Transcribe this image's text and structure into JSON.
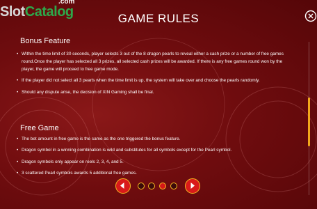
{
  "watermark": {
    "brand_part1": "Slot",
    "brand_part2": "Catalog",
    "suffix": ".com"
  },
  "header": {
    "title": "GAME RULES"
  },
  "sections": {
    "bonus": {
      "title": "Bonus Feature",
      "rules": [
        "Within the time limit of 30 seconds, player selects 3 out of the 8 dragon pearls to reveal either a cash prize or a number of free games round.Once the player has selected all 3 prizes, all selected cash prizes will be awarded. If there is any free games round won by the player, the game will proceed to free game mode.",
        "If the player did not select all 3 pearls when the time limit is up, the system will take over and choose the pearls randomly.",
        "Should any dispute arise, the decision of XIN Gaming shall be final."
      ]
    },
    "free": {
      "title": "Free Game",
      "rules": [
        "The bet amount in free game is the same as the one triggered the bonus feature.",
        "Dragon symbol in a winning combination is wild and substitutes for all symbols except for the Pearl symbol.",
        "Dragon symbols only appear on reels 2, 3, 4, and 5.",
        "3 scattered Pearl symbols awards 5 additional free games."
      ]
    }
  },
  "pagination": {
    "total_pages": 4,
    "current_page": 3
  },
  "scrollbar": {
    "position_fraction": 0.45
  },
  "colors": {
    "background": "#7a0f12",
    "accent_gold": "#f5b820",
    "button_red": "#d91a1a",
    "scroll_thumb": "#f2a81c"
  },
  "icons": {
    "close": "close-icon",
    "prev": "chevron-left-icon",
    "next": "chevron-right-icon"
  }
}
